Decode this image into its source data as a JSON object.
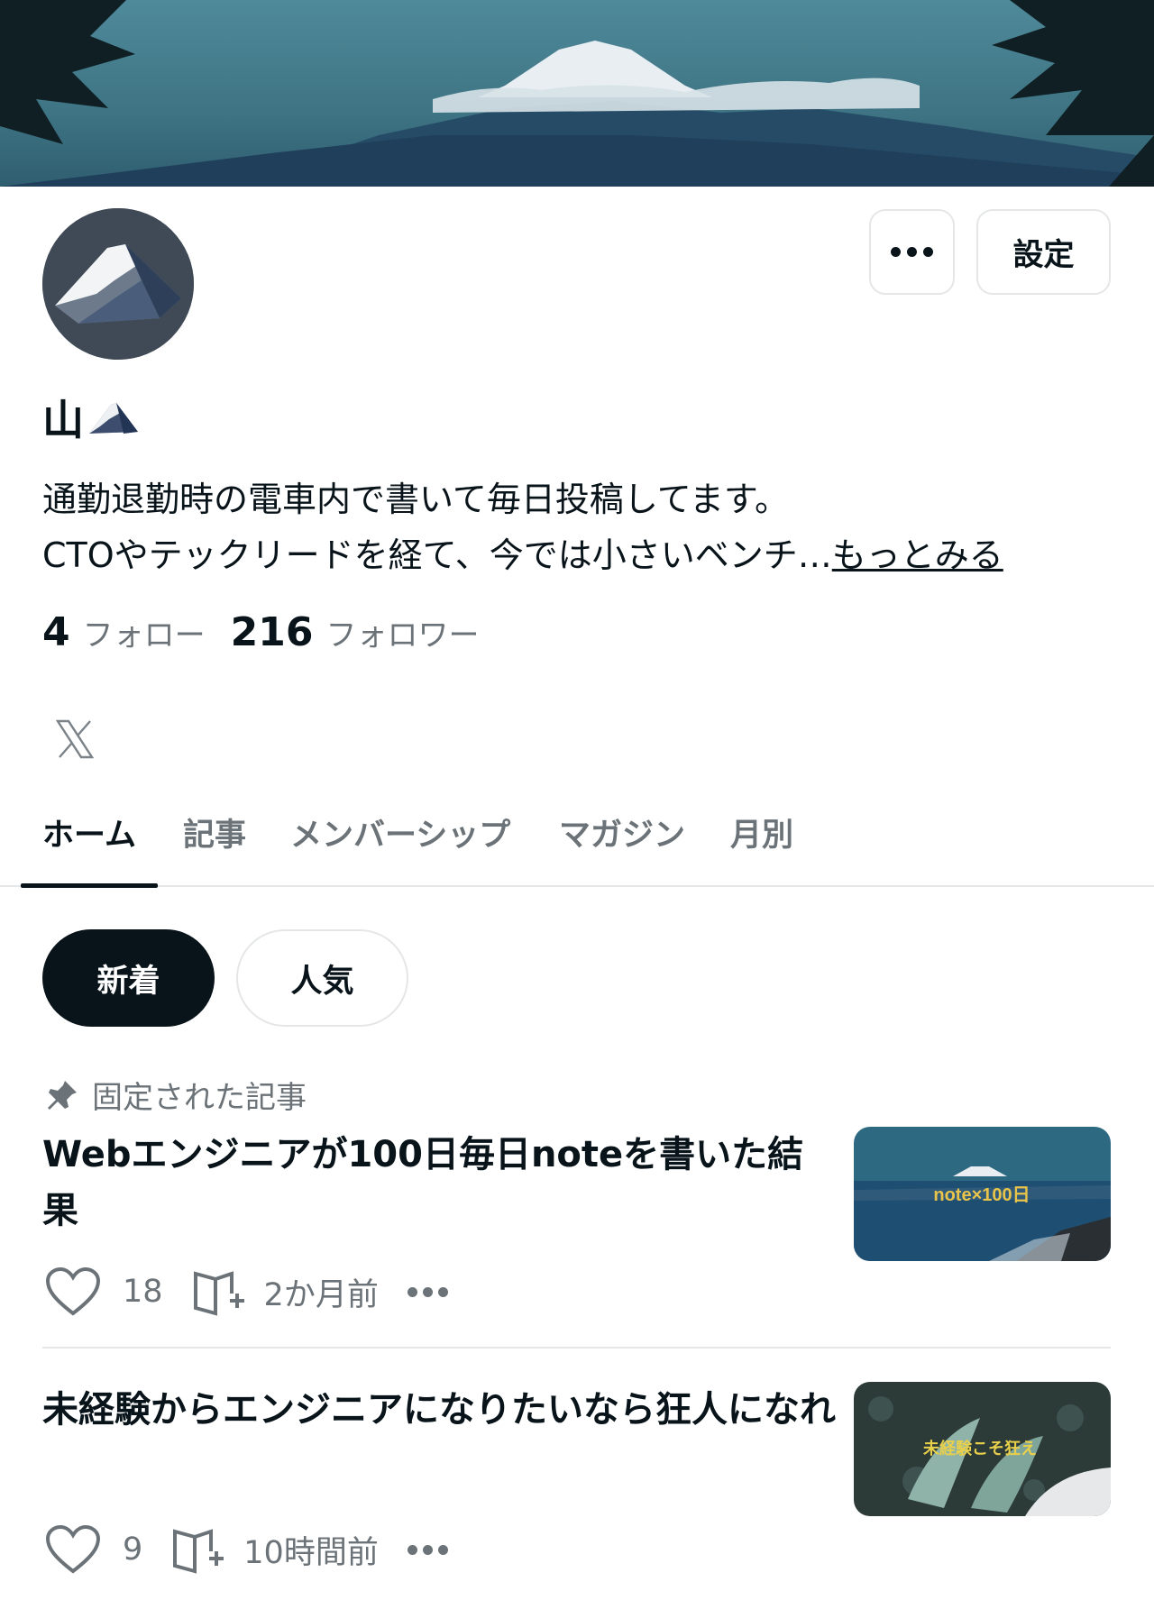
{
  "header": {
    "cover_alt": "Mount Fuji header",
    "cover_icon": "mountain-landscape"
  },
  "profile": {
    "name": "山",
    "name_emoji_icon": "snow-capped-mountain-icon",
    "bio_line1": "通勤退勤時の電車内で書いて毎日投稿してます。",
    "bio_line2": "CTOやテックリードを経て、今では小さいベンチ…",
    "more_link": "もっとみる",
    "follow_count": "4",
    "follow_label": "フォロー",
    "follower_count": "216",
    "follower_label": "フォロワー"
  },
  "actions": {
    "more_icon": "ellipsis-icon",
    "settings_label": "設定"
  },
  "tabs": [
    {
      "label": "ホーム",
      "active": true
    },
    {
      "label": "記事"
    },
    {
      "label": "メンバーシップ"
    },
    {
      "label": "マガジン"
    },
    {
      "label": "月別"
    }
  ],
  "filters": {
    "new_label": "新着",
    "popular_label": "人気"
  },
  "pinned_label": "固定された記事",
  "articles": [
    {
      "title": "Webエンジニアが100日毎日noteを書いた結果",
      "likes": "18",
      "time": "2か月前",
      "thumb_text": "note×100日"
    },
    {
      "title": "未経験からエンジニアになりたいなら狂人になれ",
      "likes": "9",
      "time": "10時間前",
      "thumb_text": "未経験こそ狂え"
    }
  ],
  "colors": {
    "text": "#08131a",
    "muted": "#6b7378",
    "border": "#e4e6e8",
    "accent_dark": "#08131a"
  }
}
